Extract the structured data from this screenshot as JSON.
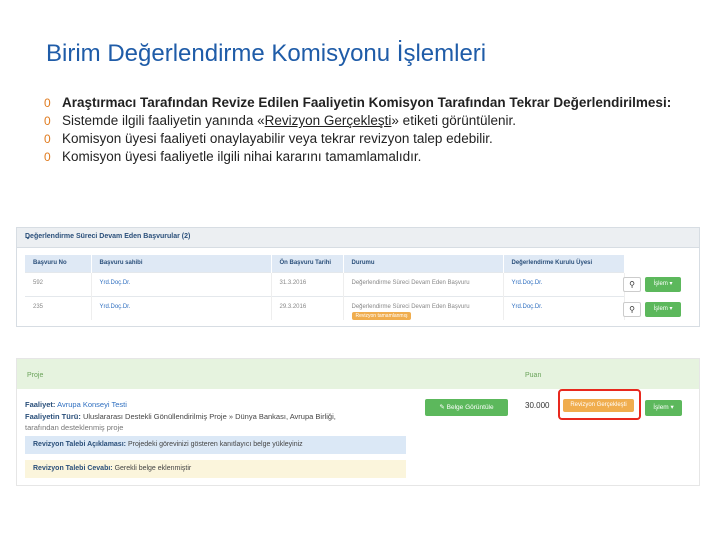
{
  "title": "Birim Değerlendirme Komisyonu İşlemleri",
  "bullets": [
    {
      "marker": "0",
      "text": "Araştırmacı Tarafından Revize Edilen Faaliyetin Komisyon Tarafından Tekrar Değerlendirilmesi:"
    },
    {
      "marker": "0",
      "text_before": "Sistemde ilgili faaliyetin yanında «",
      "link": "Revizyon Gerçekleşti",
      "text_after": "» etiketi görüntülenir."
    },
    {
      "marker": "0",
      "text": "Komisyon üyesi faaliyeti onaylayabilir veya tekrar revizyon talep edebilir."
    },
    {
      "marker": "0",
      "text": "Komisyon üyesi faaliyetle ilgili nihai kararını tamamlamalıdır."
    }
  ],
  "panel1": {
    "heading": "Değerlendirme Süreci Devam Eden Başvurular (2)",
    "columns": [
      "Başvuru No",
      "Başvuru sahibi",
      "Ön Başvuru Tarihi",
      "Durumu",
      "Değerlendirme Kurulu Üyesi"
    ],
    "rows": [
      {
        "no": "592",
        "owner": "Yrd.Doç.Dr.",
        "date": "31.3.2016",
        "status": "Değerlendirme Süreci Devam Eden Başvuru",
        "member": "Yrd.Doç.Dr."
      },
      {
        "no": "235",
        "owner": "Yrd.Doç.Dr.",
        "date": "29.3.2016",
        "status": "Değerlendirme Süreci Devam Eden Başvuru",
        "tag": "Revizyon tamamlanmış",
        "member": "Yrd.Doç.Dr."
      }
    ],
    "action_label": "İşlem ▾"
  },
  "panel2": {
    "col_proje": "Proje",
    "col_puan": "Puan",
    "faaliyet_label": "Faaliyet:",
    "faaliyet_value": "Avrupa Konseyi Testi",
    "turu_label": "Faaliyetin Türü:",
    "turu_value": "Uluslararası Destekli Gönüllendirilmiş Proje » Dünya Bankası, Avrupa Birliği,",
    "turu_value_2": "tarafından desteklenmiş proje",
    "belge_button": "Belge Görüntüle",
    "puan_value": "30.000",
    "revizyon_button": "Revizyon Gerçekleşti",
    "islem_button": "İşlem ▾",
    "aciklama_label": "Revizyon Talebi Açıklaması:",
    "aciklama_value": "Projedeki görevinizi gösteren kanıtlayıcı belge yükleyiniz",
    "cevabi_label": "Revizyon Talebi Cevabı:",
    "cevabi_value": "Gerekli belge eklenmiştir"
  },
  "colors": {
    "title": "#1f5ca8",
    "bullet_marker": "#e07b1f",
    "green": "#5cb85c",
    "orange": "#f0ad4e",
    "highlight_border": "#e8281e"
  }
}
